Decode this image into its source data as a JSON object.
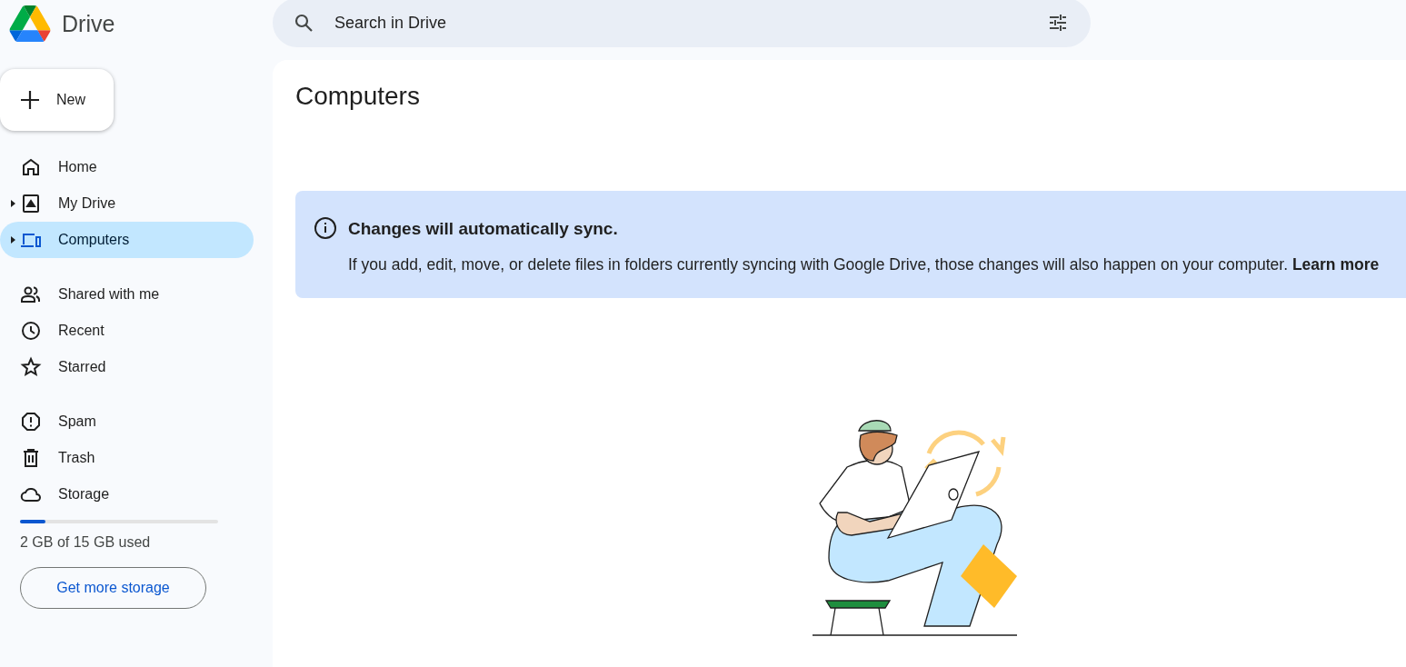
{
  "app": {
    "name": "Drive"
  },
  "search": {
    "placeholder": "Search in Drive"
  },
  "new_button": {
    "label": "New"
  },
  "nav_groups": [
    [
      {
        "label": "Home",
        "expandable": false,
        "selected": false
      },
      {
        "label": "My Drive",
        "expandable": true,
        "selected": false
      },
      {
        "label": "Computers",
        "expandable": true,
        "selected": true
      }
    ],
    [
      {
        "label": "Shared with me",
        "expandable": false,
        "selected": false
      },
      {
        "label": "Recent",
        "expandable": false,
        "selected": false
      },
      {
        "label": "Starred",
        "expandable": false,
        "selected": false
      }
    ],
    [
      {
        "label": "Spam",
        "expandable": false,
        "selected": false
      },
      {
        "label": "Trash",
        "expandable": false,
        "selected": false
      },
      {
        "label": "Storage",
        "expandable": false,
        "selected": false
      }
    ]
  ],
  "storage": {
    "level": 0.13,
    "usage": "2 GB of 15 GB used",
    "button": "Get more storage"
  },
  "page": {
    "title": "Computers"
  },
  "banner": {
    "title": "Changes will automatically sync.",
    "text": "If you add, edit, move, or delete files in folders currently syncing with Google Drive, those changes will also happen on your computer.",
    "link": "Learn more"
  }
}
